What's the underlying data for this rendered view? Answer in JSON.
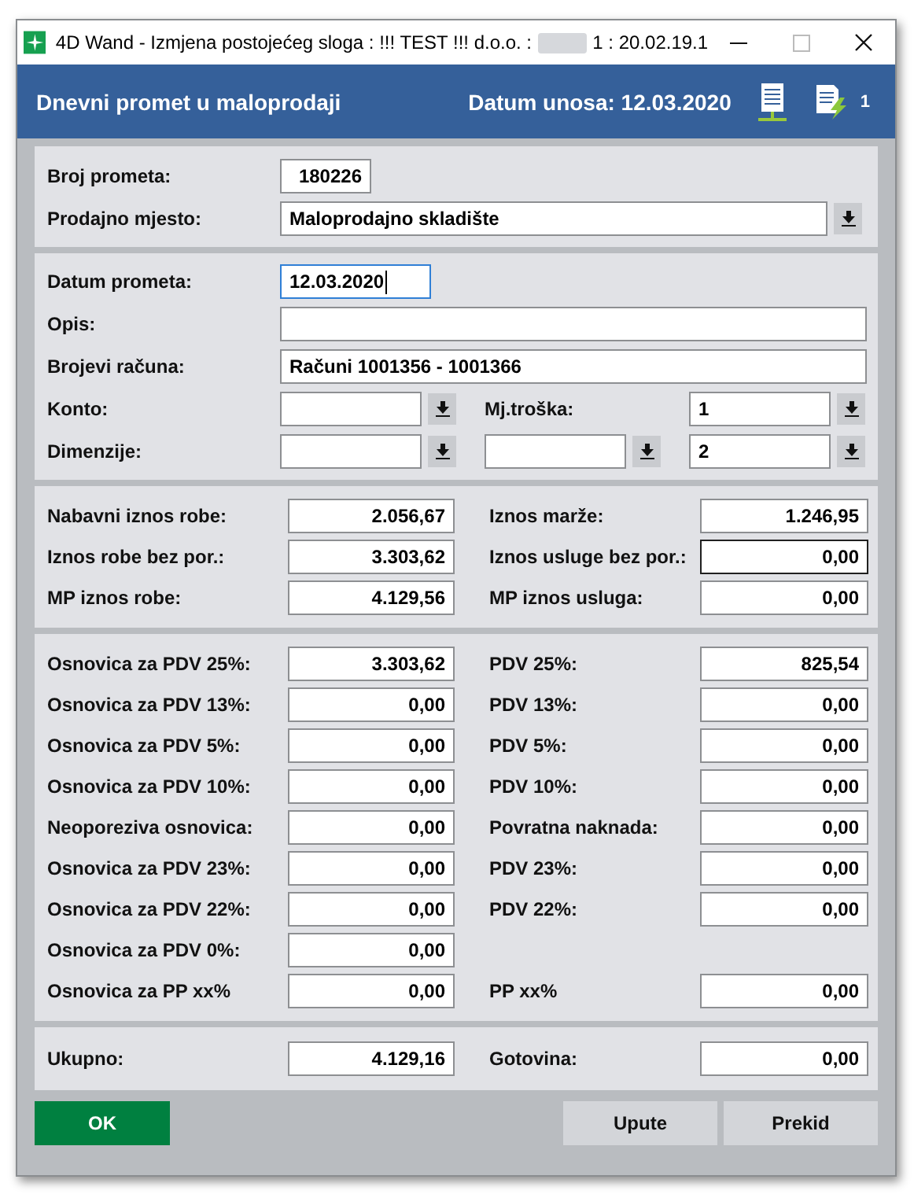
{
  "window": {
    "title_start": "4D Wand - Izmjena postojećeg sloga : !!! TEST !!! d.o.o. :",
    "title_end": "1 : 20.02.19.1"
  },
  "header": {
    "title": "Dnevni promet u maloprodaji",
    "date_text": "Datum unosa: 12.03.2020",
    "badge": "1"
  },
  "top_fields": [
    {
      "label": "Broj prometa:",
      "value": "180226",
      "kind": "short"
    },
    {
      "label": "Prodajno mjesto:",
      "value": "Maloprodajno skladište",
      "kind": "dropdown"
    }
  ],
  "details": [
    {
      "label": "Datum prometa:",
      "value": "12.03.2020",
      "kind": "date",
      "focused": true
    },
    {
      "label": "Opis:",
      "kind": "wide",
      "focused": false
    },
    {
      "label": "Brojevi računa:",
      "value": "Računi 1001356 - 1001366",
      "kind": "wide",
      "focused": false
    }
  ],
  "codes": [
    {
      "kind": "labeled",
      "label": "Konto:",
      "right_label": "Mj.troška:",
      "right_value": "1"
    },
    {
      "kind": "triple",
      "label": "Dimenzije:",
      "right_value": "2"
    }
  ],
  "amounts": [
    {
      "left": {
        "label": "Nabavni iznos robe:",
        "value": "2.056,67"
      },
      "right": {
        "label": "Iznos marže:",
        "value": "1.246,95",
        "focused": false
      }
    },
    {
      "left": {
        "label": "Iznos robe bez por.:",
        "value": "3.303,62"
      },
      "right": {
        "label": "Iznos usluge bez por.:",
        "value": "0,00",
        "focused": true
      }
    },
    {
      "left": {
        "label": "MP iznos robe:",
        "value": "4.129,56"
      },
      "right": {
        "label": "MP iznos usluga:",
        "value": "0,00",
        "focused": false
      }
    }
  ],
  "taxes": [
    {
      "left": {
        "label": "Osnovica za PDV 25%:",
        "value": "3.303,62"
      },
      "right": {
        "label": "PDV 25%:",
        "value": "825,54"
      }
    },
    {
      "left": {
        "label": "Osnovica za PDV 13%:",
        "value": "0,00"
      },
      "right": {
        "label": "PDV 13%:",
        "value": "0,00"
      }
    },
    {
      "left": {
        "label": "Osnovica za PDV 5%:",
        "value": "0,00"
      },
      "right": {
        "label": "PDV 5%:",
        "value": "0,00"
      }
    },
    {
      "left": {
        "label": "Osnovica za PDV 10%:",
        "value": "0,00"
      },
      "right": {
        "label": "PDV 10%:",
        "value": "0,00"
      }
    },
    {
      "left": {
        "label": "Neoporeziva osnovica:",
        "value": "0,00"
      },
      "right": {
        "label": "Povratna naknada:",
        "value": "0,00"
      }
    },
    {
      "left": {
        "label": "Osnovica za PDV 23%:",
        "value": "0,00"
      },
      "right": {
        "label": "PDV 23%:",
        "value": "0,00"
      }
    },
    {
      "left": {
        "label": "Osnovica za PDV 22%:",
        "value": "0,00"
      },
      "right": {
        "label": "PDV 22%:",
        "value": "0,00"
      }
    },
    {
      "left": {
        "label": "Osnovica za PDV 0%:",
        "value": "0,00"
      }
    },
    {
      "left": {
        "label": "Osnovica za PP xx%",
        "value": "0,00"
      },
      "right": {
        "label": "PP xx%",
        "value": "0,00"
      }
    }
  ],
  "totals": {
    "left": {
      "label": "Ukupno:",
      "value": "4.129,16"
    },
    "right": {
      "label": "Gotovina:",
      "value": "0,00"
    }
  },
  "buttons": [
    {
      "label": "OK",
      "kind": "primary"
    },
    {
      "label": "Upute",
      "kind": "secondary"
    },
    {
      "label": "Prekid",
      "kind": "secondary"
    }
  ]
}
